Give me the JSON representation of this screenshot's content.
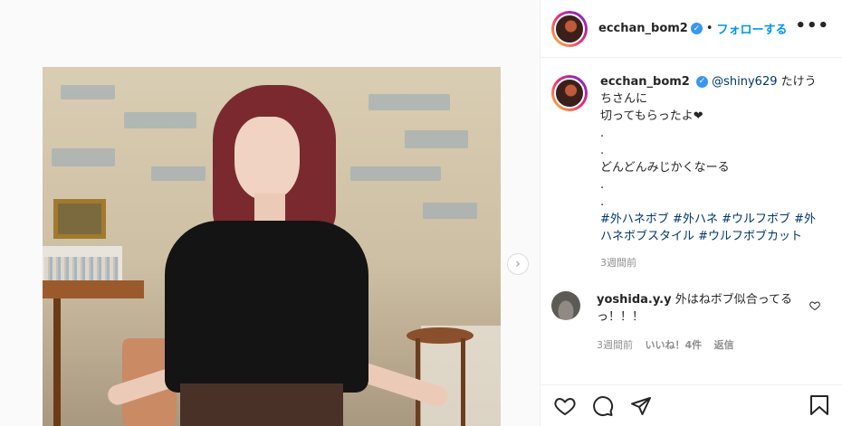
{
  "post": {
    "username": "ecchan_bom2",
    "follow_label": "フォローする",
    "dot": "•",
    "more_label": "•••"
  },
  "caption": {
    "username": "ecchan_bom2",
    "mention": "@shiny629",
    "line1": " たけうちさんに",
    "line2": "切ってもらったよ❤",
    "dot1": ".",
    "dot2": ".",
    "line3": "どんどんみじかくなーる",
    "dot3": ".",
    "dot4": ".",
    "tags": [
      "#外ハネボブ",
      "#外ハネ",
      "#ウルフボブ",
      "#外ハネボブスタイル",
      "#ウルフボブカット"
    ],
    "time": "3週間前"
  },
  "reply": {
    "username": "yoshida.y.y",
    "text": " 外はねボブ似合ってるっ！！！",
    "time": "3週間前",
    "likes": "いいね！4件",
    "reply_label": "返信"
  },
  "icons": {
    "verified": "verified-badge-icon",
    "more": "more-options-icon",
    "next": "chevron-right-icon",
    "like": "heart-icon",
    "comment": "comment-icon",
    "share": "share-icon",
    "save": "bookmark-icon"
  },
  "colors": {
    "accent": "#0095f6",
    "verified": "#3897f0",
    "link": "#00376b",
    "muted": "#8e8e8e"
  }
}
